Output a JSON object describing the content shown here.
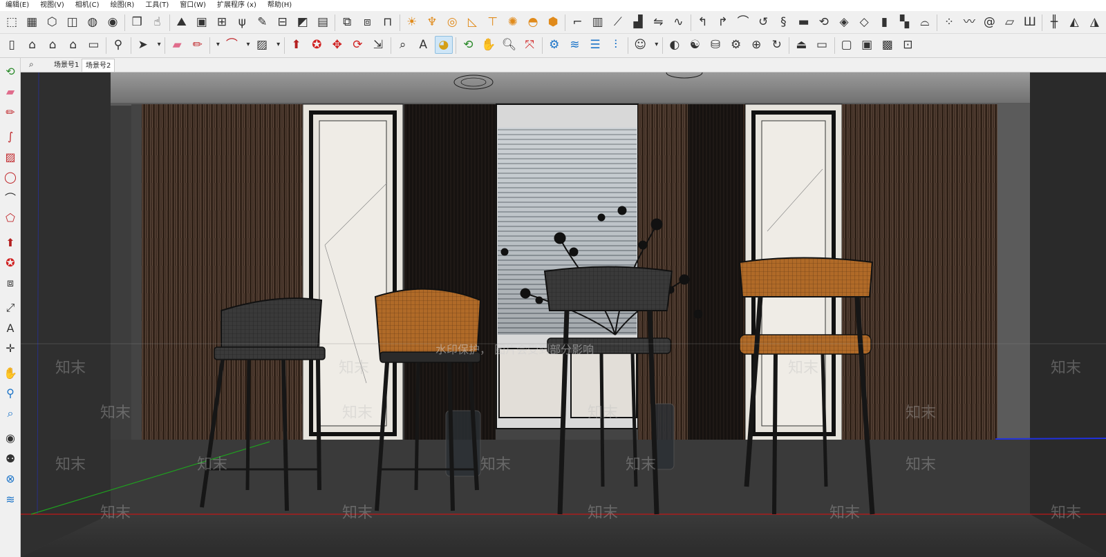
{
  "menu": {
    "items": [
      "编辑(E)",
      "视图(V)",
      "相机(C)",
      "绘图(R)",
      "工具(T)",
      "窗口(W)",
      "扩展程序 (x)",
      "帮助(H)"
    ]
  },
  "toolbar1": {
    "icons": [
      "select-box-icon",
      "front-view-icon",
      "iso-cube-icon",
      "cube-outline-icon",
      "xray-sphere-icon",
      "shaded-sphere-icon",
      "component-icon",
      "pointer-hand-icon",
      "terrain-icon",
      "box-icon",
      "cube-add-icon",
      "grass-icon",
      "pen-icon",
      "grid-box-icon",
      "edit-plane-icon",
      "grid-icon",
      "shape-join-icon",
      "shape-split-icon",
      "table-icon",
      "sun-icon",
      "lamp-icon",
      "ring-icon",
      "triangle-ruler-icon",
      "pipe-icon",
      "spark-icon",
      "dome-icon",
      "cube-gold-icon",
      "stairs-icon",
      "column-icon",
      "ramp-icon",
      "bar-chart-icon",
      "flip-icon",
      "wave-icon",
      "curve-a-icon",
      "curve-b-icon",
      "arc-icon",
      "loop-icon",
      "snake-icon",
      "slab-icon",
      "path-icon",
      "diamond-icon",
      "diamond-b-icon",
      "block-icon",
      "blocks-icon",
      "bridge-icon",
      "dots-icon",
      "line-curve-icon",
      "spiral-icon",
      "ruler-icon",
      "comb-icon",
      "fence-icon",
      "mirror-icon",
      "split-icon"
    ]
  },
  "toolbar2": {
    "icons": [
      "book-icon",
      "home-icon",
      "house-roof-icon",
      "house-outline-icon",
      "garage-icon",
      "zoom-icon",
      "select-arrow-icon",
      "dropdown-icon",
      "eraser-icon",
      "pencil-icon",
      "dropdown-icon",
      "arc-tool-icon",
      "dropdown-icon",
      "rectangle-tool-icon",
      "dropdown-icon",
      "push-pull-icon",
      "follow-me-icon",
      "move-icon",
      "rotate-icon",
      "scale-icon",
      "tape-icon",
      "text-tool-icon",
      "paint-bucket-icon",
      "orbit-icon",
      "pan-hand-icon",
      "zoom-lens-icon",
      "zoom-extents-icon",
      "gear-cube-icon",
      "layers-icon",
      "stack-icon",
      "sections-icon",
      "user-circle-icon",
      "dropdown-icon",
      "sandbox-icon",
      "palette-icon",
      "bucket-icon",
      "gear-lines-icon",
      "globe-icon",
      "refresh-icon",
      "warehouse-icon",
      "screen-icon",
      "window-icon",
      "window-b-icon",
      "photo-icon",
      "lock-icon"
    ]
  },
  "scene_tabs": [
    "场景号1",
    "场景号2"
  ],
  "active_scene_tab": 1,
  "left_toolbar": {
    "icons": [
      "orbit-icon",
      "eraser-icon",
      "pencil-icon",
      "freehand-icon",
      "rectangle-icon",
      "circle-icon",
      "arc-icon",
      "polygon-icon",
      "push-pull-icon",
      "follow-me-icon",
      "offset-icon",
      "tape-measure-icon",
      "text-icon",
      "axes-icon",
      "pan-icon",
      "zoom-icon",
      "zoom-window-icon",
      "eye-icon",
      "walk-icon",
      "section-icon",
      "layers-icon"
    ]
  },
  "viewport": {
    "watermark_text": "水印保护，  图片会受到部分影响",
    "brand_text": "知末"
  },
  "colors": {
    "accent_active": "#cfe6f7",
    "axis_red": "#d42020",
    "axis_green": "#1fa01f",
    "axis_blue": "#2030e0",
    "chair_orange": "#b06a28",
    "curtain_brown": "#3a2a20"
  }
}
